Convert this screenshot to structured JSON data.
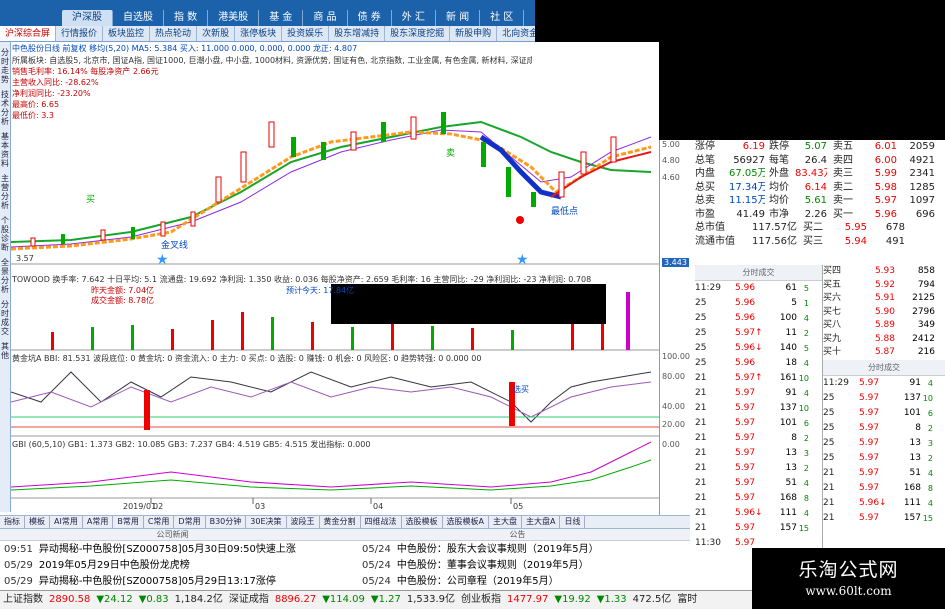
{
  "top_menu": {
    "app_title": "",
    "items": [
      "沪深股",
      "自选股",
      "指 数",
      "港美股",
      "基 金",
      "商 品",
      "债 券",
      "外 汇",
      "新 闻",
      "社 区"
    ]
  },
  "sub_tabs": [
    "沪深综合屏",
    "行情报价",
    "板块监控",
    "热点轮动",
    "次新股",
    "涨停板块",
    "投资娱乐",
    "股东增减持",
    "股东深度挖掘",
    "新股申购",
    "北向资金"
  ],
  "left_tabs": [
    "分时走势",
    "技术分析",
    "基本资料",
    "主营分析",
    "个股诊断",
    "全景分析",
    "分时成交",
    "其他"
  ],
  "chart": {
    "title_line": "中色股份日线 前复权 移均(5,20) MA5: 5.384 买入: 11.000 0.000, 0.000, 0.000 龙正: 4.807",
    "info_lines": [
      "所属板块: 自选股5, 北京市, 国证A指, 国证1000, 巨潮小盘, 中小盘, 1000材料, 资源优势, 国证有色, 北京指数, 工业金属, 有色金属, 新材料, 深证成指, 中盘",
      "销售毛利率: 16.14% 每股净资产 2.66元",
      "主营收入同比: -28.62%",
      "净利润同比: -23.20%",
      "最高价: 6.65",
      "最低价: 3.3"
    ],
    "price_low_label": "3.57",
    "price_low_right": "3.443",
    "labels": {
      "buy": "买",
      "buy_signal": "金叉线",
      "sell": "卖",
      "low": "最低点"
    }
  },
  "vol_line": "TOWOOD 换手率: 7.642 十日平均: 5.1 流通盘: 19.692 净利润: 1.350 收益: 0.036 每股净资产: 2.659 毛利率: 16 主营同比: -29 净利润比: -23 净利润: 0.708",
  "vol_sub": [
    "昨天金额: 7.04亿",
    "成交金额: 8.78亿"
  ],
  "vol_sub2": "预计今天: 17.84亿",
  "kdj_line": "黄金坑A BBI: 81.531 波段底位: 0 黄金坑: 0 资金流入: 0 主力: 0 买点: 0 选股: 0 赚钱: 0 机会: 0 风险区: 0 趋势转强: 0 0.000 00",
  "kdj_text": "选买",
  "bottom_ind": "GBI (60,5,10) GB1: 1.373 GB2: 10.085 GB3: 7.237 GB4: 4.519 GB5: 4.515 发出指标: 0.000",
  "date_labels": [
    "2019/01",
    "02",
    "03",
    "04",
    "05"
  ],
  "axis_labels": [
    "100.00",
    "80.00",
    "40.00",
    "20.00",
    "0.00",
    "5.00",
    "4.80",
    "4.60"
  ],
  "quote": {
    "rows": [
      {
        "k1": "涨停",
        "v1": "6.19",
        "k2": "跌停",
        "v2": "5.07",
        "k3": "卖五",
        "v3": "6.01",
        "v4": "2059"
      },
      {
        "k1": "总笔",
        "v1": "56927",
        "k2": "每笔",
        "v2": "26.4",
        "k3": "卖四",
        "v3": "6.00",
        "v4": "4921"
      },
      {
        "k1": "内盘",
        "v1": "67.05万",
        "k2": "外盘",
        "v2": "83.43万",
        "k3": "卖三",
        "v3": "5.99",
        "v4": "2341"
      },
      {
        "k1": "总买",
        "v1": "17.34万",
        "k2": "均价",
        "v2": "6.14",
        "k3": "卖二",
        "v3": "5.98",
        "v4": "1285"
      },
      {
        "k1": "总卖",
        "v1": "11.15万",
        "k2": "均价",
        "v2": "5.61",
        "k3": "卖一",
        "v3": "5.97",
        "v4": "1097"
      },
      {
        "k1": "市盈",
        "v1": "41.49",
        "k2": "市净",
        "v2": "2.26",
        "k3": "买一",
        "v3": "5.96",
        "v4": "696"
      },
      {
        "k1": "总市值",
        "v1": "117.57亿",
        "k2": "",
        "v2": "",
        "k3": "买二",
        "v3": "5.95",
        "v4": "678"
      },
      {
        "k1": "流通市值",
        "v1": "117.56亿",
        "k2": "",
        "v2": "",
        "k3": "买三",
        "v3": "5.94",
        "v4": "491"
      }
    ],
    "bid_more": [
      {
        "k": "买四",
        "p": "5.93",
        "v": "858"
      },
      {
        "k": "买五",
        "p": "5.92",
        "v": "794"
      },
      {
        "k": "买六",
        "p": "5.91",
        "v": "2125"
      },
      {
        "k": "买七",
        "p": "5.90",
        "v": "2796"
      },
      {
        "k": "买八",
        "p": "5.89",
        "v": "349"
      },
      {
        "k": "买九",
        "p": "5.88",
        "v": "2412"
      },
      {
        "k": "买十",
        "p": "5.87",
        "v": "216"
      }
    ]
  },
  "ticks_header": "分时成交",
  "ticks_left": [
    {
      "t": "11:29",
      "p": "5.96",
      "v": "61",
      "f": "5"
    },
    {
      "t": "25",
      "p": "5.96",
      "v": "5",
      "f": "1"
    },
    {
      "t": "25",
      "p": "5.96",
      "v": "100",
      "f": "4"
    },
    {
      "t": "25",
      "p": "5.97↑",
      "v": "11",
      "f": "2"
    },
    {
      "t": "25",
      "p": "5.96↓",
      "v": "140",
      "f": "5"
    },
    {
      "t": "25",
      "p": "5.96",
      "v": "18",
      "f": "4"
    },
    {
      "t": "21",
      "p": "5.97↑",
      "v": "161",
      "f": "10"
    },
    {
      "t": "21",
      "p": "5.97",
      "v": "91",
      "f": "4"
    },
    {
      "t": "21",
      "p": "5.97",
      "v": "137",
      "f": "10"
    },
    {
      "t": "21",
      "p": "5.97",
      "v": "101",
      "f": "6"
    },
    {
      "t": "21",
      "p": "5.97",
      "v": "8",
      "f": "2"
    },
    {
      "t": "21",
      "p": "5.97",
      "v": "13",
      "f": "3"
    },
    {
      "t": "21",
      "p": "5.97",
      "v": "13",
      "f": "2"
    },
    {
      "t": "21",
      "p": "5.97",
      "v": "51",
      "f": "4"
    },
    {
      "t": "21",
      "p": "5.97",
      "v": "168",
      "f": "8"
    },
    {
      "t": "21",
      "p": "5.96↓",
      "v": "111",
      "f": "4"
    },
    {
      "t": "21",
      "p": "5.97",
      "v": "157",
      "f": "15"
    },
    {
      "t": "11:30",
      "p": "5.97",
      "v": "",
      "f": ""
    }
  ],
  "ticks_right": [
    {
      "t": "11:29",
      "p": "5.97",
      "v": "91",
      "f": "4"
    },
    {
      "t": "25",
      "p": "5.97",
      "v": "137",
      "f": "10"
    },
    {
      "t": "25",
      "p": "5.97",
      "v": "101",
      "f": "6"
    },
    {
      "t": "25",
      "p": "5.97",
      "v": "8",
      "f": "2"
    },
    {
      "t": "25",
      "p": "5.97",
      "v": "13",
      "f": "3"
    },
    {
      "t": "25",
      "p": "5.97",
      "v": "13",
      "f": "2"
    },
    {
      "t": "21",
      "p": "5.97",
      "v": "51",
      "f": "4"
    },
    {
      "t": "21",
      "p": "5.97",
      "v": "168",
      "f": "8"
    },
    {
      "t": "21",
      "p": "5.96↓",
      "v": "111",
      "f": "4"
    },
    {
      "t": "21",
      "p": "5.97",
      "v": "157",
      "f": "15"
    }
  ],
  "bottom_tabs": [
    "指标",
    "模板",
    "AI常用",
    "A常用",
    "B常用",
    "C常用",
    "D常用",
    "B30分钟",
    "30E决策",
    "波段王",
    "黄金分割",
    "四维战法",
    "选股模板",
    "选股模板A",
    "主大盘",
    "主大盘A",
    "日线"
  ],
  "news": {
    "header_left": "公司新闻",
    "header_right": "公告",
    "left": [
      {
        "d": "09:51",
        "t": "异动揭秘-中色股份[SZ000758]05月30日09:50快速上涨"
      },
      {
        "d": "05/29",
        "t": "2019年05月29日中色股份龙虎榜"
      },
      {
        "d": "05/29",
        "t": "异动揭秘-中色股份[SZ000758]05月29日13:17涨停"
      }
    ],
    "right": [
      {
        "d": "05/24",
        "t": "中色股份：股东大会议事规则（2019年5月）"
      },
      {
        "d": "05/24",
        "t": "中色股份：董事会议事规则（2019年5月）"
      },
      {
        "d": "05/24",
        "t": "中色股份：公司章程（2019年5月）"
      }
    ]
  },
  "status": [
    "上证指数",
    "2890.58",
    "▼24.12",
    "▼0.83",
    "1,184.2亿",
    "深证成指",
    "8896.27",
    "▼114.09",
    "▼1.27",
    "1,533.9亿",
    "创业板指",
    "1477.97",
    "▼19.92",
    "▼1.33",
    "472.5亿",
    "富时"
  ],
  "logo": {
    "l1": "乐淘公式网",
    "l2": "www.60lt.com"
  },
  "side_buttons": [
    "逐",
    "单",
    "指",
    "闻"
  ]
}
